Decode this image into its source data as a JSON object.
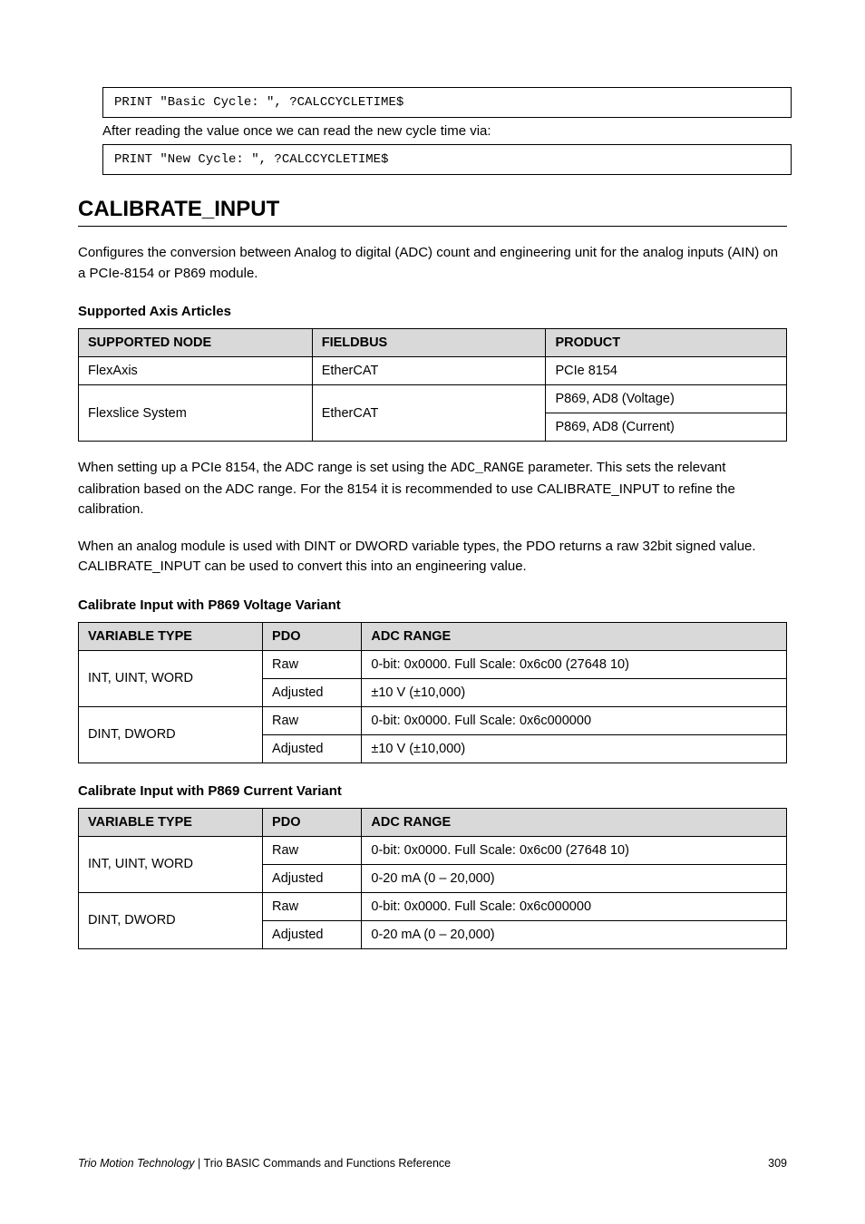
{
  "code_lines": {
    "line1": "PRINT \"Basic Cycle: \", ?CALCCYCLETIME$",
    "after1": "After reading the value once we can read the new cycle time via:",
    "line2": "PRINT \"New Cycle: \", ?CALCCYCLETIME$"
  },
  "section": {
    "heading": "CALIBRATE_INPUT",
    "para1": "Configures the conversion between Analog to digital (ADC) count and engineering unit for the analog inputs (AIN) on a PCIe-8154 or P869 module.",
    "caption1": "Supported Axis Articles",
    "table1": {
      "headers": [
        "SUPPORTED NODE",
        "FIELDBUS",
        "PRODUCT"
      ],
      "rows": [
        {
          "node": "FlexAxis",
          "fieldbus": "EtherCAT",
          "product": "PCIe 8154"
        },
        {
          "node": "Flexslice System",
          "fieldbus": "EtherCAT",
          "product": [
            "P869, AD8 (Voltage)",
            "P869, AD8 (Current)"
          ]
        }
      ]
    },
    "para2_runs": [
      "When setting up a PCIe 8154, the ADC range is set using the ",
      "ADC_RANGE",
      " parameter. This sets the relevant calibration based on the ADC range. For the 8154 it is recommended to use CALIBRATE_INPUT to refine the calibration."
    ],
    "para3": "When an analog module is used with DINT or DWORD variable types, the PDO returns a raw 32bit signed value. CALIBRATE_INPUT can be used to convert this into an engineering value.",
    "caption2": "Calibrate Input with P869 Voltage Variant",
    "table2": {
      "headers": [
        "VARIABLE TYPE",
        "PDO",
        "ADC RANGE"
      ],
      "rows": [
        {
          "vartype": "INT, UINT, WORD",
          "sub": [
            {
              "pdo": "Raw",
              "adc": "0-bit: 0x0000. Full Scale: 0x6c00 (27648 10)"
            },
            {
              "pdo": "Adjusted",
              "adc": "±10 V (±10,000)"
            }
          ]
        },
        {
          "vartype": "DINT, DWORD",
          "sub": [
            {
              "pdo": "Raw",
              "adc": "0-bit: 0x0000. Full Scale: 0x6c000000"
            },
            {
              "pdo": "Adjusted",
              "adc": "±10 V (±10,000)"
            }
          ]
        }
      ]
    },
    "caption3": "Calibrate Input with P869 Current Variant",
    "table3": {
      "headers": [
        "VARIABLE TYPE",
        "PDO",
        "ADC RANGE"
      ],
      "rows": [
        {
          "vartype": "INT, UINT, WORD",
          "sub": [
            {
              "pdo": "Raw",
              "adc": "0-bit: 0x0000. Full Scale: 0x6c00 (27648 10)"
            },
            {
              "pdo": "Adjusted",
              "adc": "0-20 mA (0 – 20,000)"
            }
          ]
        },
        {
          "vartype": "DINT, DWORD",
          "sub": [
            {
              "pdo": "Raw",
              "adc": "0-bit: 0x0000. Full Scale: 0x6c000000"
            },
            {
              "pdo": "Adjusted",
              "adc": "0-20 mA (0 – 20,000)"
            }
          ]
        }
      ]
    }
  },
  "footer": {
    "left_runs": [
      "Trio Motion Technology",
      "   ",
      "|",
      "    ",
      "Trio BASIC Commands and Functions Reference"
    ],
    "right": "309"
  }
}
